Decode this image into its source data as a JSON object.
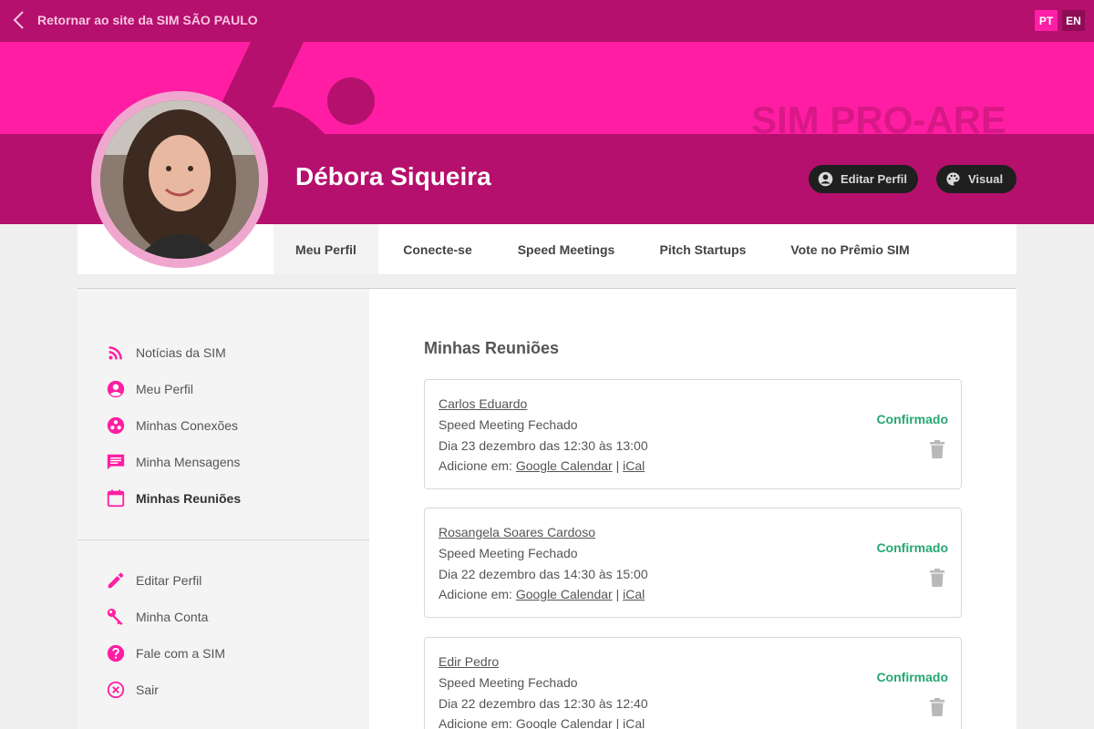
{
  "topbar": {
    "back_label": "Retornar ao site da SIM SÃO PAULO",
    "languages": [
      "PT",
      "EN"
    ]
  },
  "banner": {
    "brand": "SIM PRO-AREA",
    "user_name": "Débora Siqueira",
    "edit_profile_label": "Editar Perfil",
    "visual_label": "Visual"
  },
  "tabs": [
    {
      "label": "Meu Perfil"
    },
    {
      "label": "Conecte-se"
    },
    {
      "label": "Speed Meetings"
    },
    {
      "label": "Pitch Startups"
    },
    {
      "label": "Vote no Prêmio SIM"
    }
  ],
  "sidebar": {
    "items": [
      {
        "label": "Notícias da SIM",
        "icon": "rss-icon"
      },
      {
        "label": "Meu Perfil",
        "icon": "account-circle-icon"
      },
      {
        "label": "Minhas Conexões",
        "icon": "connections-icon"
      },
      {
        "label": "Minha Mensagens",
        "icon": "message-icon"
      },
      {
        "label": "Minhas Reuniões",
        "icon": "calendar-icon"
      }
    ],
    "secondary": [
      {
        "label": "Editar Perfil",
        "icon": "pencil-icon"
      },
      {
        "label": "Minha Conta",
        "icon": "key-icon"
      },
      {
        "label": "Fale com a SIM",
        "icon": "help-icon"
      },
      {
        "label": "Sair",
        "icon": "close-circle-icon"
      }
    ]
  },
  "main": {
    "title": "Minhas Reuniões",
    "add_prefix": "Adicione em:",
    "google_label": "Google Calendar",
    "separator": "|",
    "ical_label": "iCal",
    "meetings": [
      {
        "name": "Carlos Eduardo",
        "type": "Speed Meeting Fechado",
        "when": "Dia 23 dezembro das 12:30 às 13:00",
        "status": "Confirmado"
      },
      {
        "name": "Rosangela Soares Cardoso",
        "type": "Speed Meeting Fechado",
        "when": "Dia 22 dezembro das 14:30 às 15:00",
        "status": "Confirmado"
      },
      {
        "name": "Edir Pedro",
        "type": "Speed Meeting Fechado",
        "when": "Dia 22 dezembro das 12:30 às 12:40",
        "status": "Confirmado"
      }
    ]
  },
  "colors": {
    "accent": "#ff1ea3",
    "dark_magenta": "#b5106d",
    "confirmed": "#26a871"
  }
}
